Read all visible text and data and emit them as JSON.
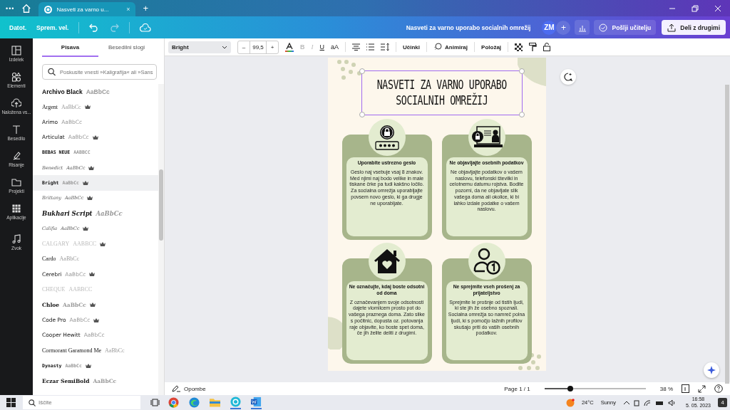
{
  "browser": {
    "menu": "•••",
    "tab": {
      "title": "Nasveti za varno u...",
      "close": "×"
    },
    "new_tab": "+"
  },
  "header": {
    "menu": [
      {
        "label": "Datot."
      },
      {
        "label": "Sprem. vel."
      }
    ],
    "doc_title": "Nasveti za varno uporabo socialnih omrežij",
    "avatar": "ZM",
    "add": "+",
    "send": "Pošlji učitelju",
    "share": "Deli z drugimi"
  },
  "rail": [
    {
      "label": "Izdelek",
      "kind": "layout"
    },
    {
      "label": "Elementi",
      "kind": "shapes"
    },
    {
      "label": "Naložena vs...",
      "kind": "upload"
    },
    {
      "label": "Besedilo",
      "kind": "text"
    },
    {
      "label": "Risanje",
      "kind": "draw"
    },
    {
      "label": "Projekti",
      "kind": "folder"
    },
    {
      "label": "Aplikacije",
      "kind": "apps"
    },
    {
      "label": "Zvok",
      "kind": "music"
    }
  ],
  "font_panel": {
    "tabs": [
      {
        "label": "Pisava",
        "selected": true
      },
      {
        "label": "Besedilni slogi",
        "selected": false
      }
    ],
    "search": {
      "placeholder": "Poskusite vnesti »Kaligrafija« ali »Sans"
    },
    "fonts": [
      {
        "name": "Archivo Black",
        "sample": "AaBbCc",
        "kind": "heavy",
        "premium": false,
        "selected": false
      },
      {
        "name": "Argent",
        "sample": "AaBbCc",
        "kind": "serif",
        "premium": true,
        "selected": false
      },
      {
        "name": "Arimo",
        "sample": "AaBbCc",
        "kind": "sans",
        "premium": false,
        "selected": false
      },
      {
        "name": "Articulat",
        "sample": "AaBbCc",
        "kind": "sans",
        "premium": true,
        "selected": false
      },
      {
        "name": "BEBAS NEUE",
        "sample": "AABBCC",
        "kind": "condensed",
        "premium": false,
        "selected": false
      },
      {
        "name": "Benedict",
        "sample": "AaBbCc",
        "kind": "script",
        "premium": true,
        "selected": false
      },
      {
        "name": "Bright",
        "sample": "AaBbCc",
        "kind": "condensed",
        "premium": true,
        "selected": true
      },
      {
        "name": "Brittany",
        "sample": "AaBbCc",
        "kind": "script",
        "premium": true,
        "selected": false
      },
      {
        "name": "Bukhari Script",
        "sample": "AaBbCc",
        "kind": "boldscript",
        "premium": false,
        "selected": false
      },
      {
        "name": "Califia",
        "sample": "AaBbCc",
        "kind": "script",
        "premium": true,
        "selected": false
      },
      {
        "name": "CALGARY",
        "sample": "AABBCC",
        "kind": "light",
        "premium": true,
        "selected": false
      },
      {
        "name": "Cardo",
        "sample": "AaBbCc",
        "kind": "serif",
        "premium": false,
        "selected": false
      },
      {
        "name": "Cerebri",
        "sample": "AaBbCc",
        "kind": "sans",
        "premium": true,
        "selected": false
      },
      {
        "name": "CHEQUE",
        "sample": "AABBCC",
        "kind": "light",
        "premium": false,
        "selected": false
      },
      {
        "name": "Chloe",
        "sample": "AaBbCc",
        "kind": "boldserif",
        "premium": true,
        "selected": false
      },
      {
        "name": "Code Pro",
        "sample": "AaBbCc",
        "kind": "sans",
        "premium": true,
        "selected": false
      },
      {
        "name": "Cooper Hewitt",
        "sample": "AaBbCc",
        "kind": "sans",
        "premium": false,
        "selected": false
      },
      {
        "name": "Cormorant Garamond Me",
        "sample": "AaBbCc",
        "kind": "serif",
        "premium": false,
        "selected": false
      },
      {
        "name": "Dynasty",
        "sample": "AaBbCc",
        "kind": "condensed",
        "premium": true,
        "selected": false
      },
      {
        "name": "Eczar SemiBold",
        "sample": "AaBbCc",
        "kind": "boldserif",
        "premium": false,
        "selected": false
      }
    ]
  },
  "toolbar": {
    "font": "Bright",
    "minus": "–",
    "size": "99,5",
    "plus": "+",
    "format": [
      {
        "label": "B",
        "disabled": true,
        "kind": "bold"
      },
      {
        "label": "I",
        "disabled": true,
        "kind": "italic"
      },
      {
        "label": "U",
        "disabled": false,
        "kind": "underline"
      },
      {
        "label": "aA",
        "disabled": false,
        "kind": "case"
      }
    ],
    "effects": "Učinki",
    "animate": "Animiraj",
    "position": "Položaj"
  },
  "poster": {
    "title": [
      "NASVETI ZA VARNO UPORABO",
      "SOCIALNIH OMREŽIJ"
    ],
    "cards": [
      {
        "heading": "Uporabite ustrezno geslo",
        "body": "Geslo naj vsebuje vsaj 8 znakov. Med njimi naj bodo velike in male tiskane črke pa tudi kakšno ločilo. Za socialna omrežja uporabljajte povsem novo geslo, ki ga drugje ne uporabljate."
      },
      {
        "heading": "Ne objavljajte osebnih podatkov",
        "body": "Ne objavljajte podatkov o vašem naslovu, telefonski številki in celotnemu datumu rojstva. Bodite pozorni, da ne objavljate slik vašega doma ali okolice, ki bi lahko izdale podatke o vašem naslovu."
      },
      {
        "heading": "Ne označujte, kdaj boste odsotni od doma",
        "body": "Z označevanjem svoje odsotnosti dajete vlomilcem prosto pot do vašega praznega doma. Zato slike s počitnic, dopusta oz. potovanja raje objavite, ko boste spet doma, če jih želite deliti z drugimi."
      },
      {
        "heading": "Ne sprejmite vseh prošenj za prijateljstvo",
        "body": "Sprejmite le prošnje od tistih ljudi, ki ste jih že osebno spoznali. Socialna omrežja so namreč polna ljudi, ki s pomočjo lažnih profilov skušajo priti do vaših osebnih podatkov."
      }
    ]
  },
  "footer": {
    "notes": "Opombe",
    "page": "Page 1 / 1",
    "zoom": {
      "level": 0.26
    },
    "zoom_label": "38 %"
  },
  "taskbar": {
    "search": {
      "placeholder": "Iščite"
    },
    "temperature": "24°C",
    "weather": "Sunny",
    "time": "16:58",
    "date": "5. 05. 2023",
    "notifications": "4"
  }
}
